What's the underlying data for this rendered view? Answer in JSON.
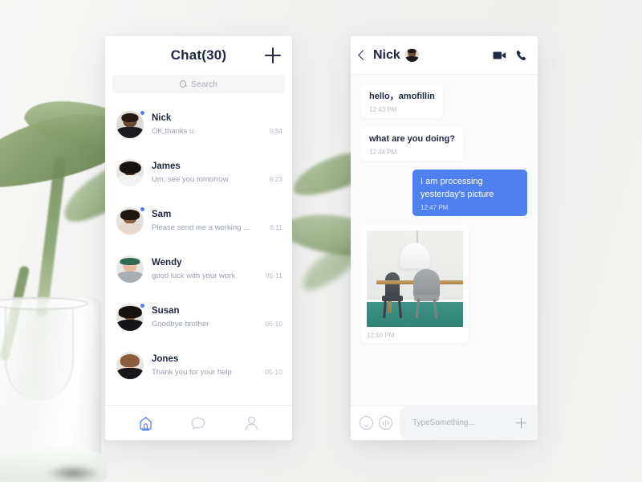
{
  "theme": {
    "accent": "#4f80f0",
    "text_dark": "#1f2740",
    "text_muted": "#9aa0ae",
    "panel_bg": "#ffffff",
    "page_bg": "#f2f2f1"
  },
  "left_panel": {
    "title": "Chat",
    "count_label": "(30)",
    "add_icon": "plus-icon",
    "search": {
      "placeholder": "Search",
      "icon": "search-icon"
    },
    "conversations": [
      {
        "name": "Nick",
        "preview": "OK,thanks u",
        "time": "9:34",
        "unread": true,
        "avatar": "avatar-nick"
      },
      {
        "name": "James",
        "preview": "Um, see you tomorrow",
        "time": "8:23",
        "unread": false,
        "avatar": "avatar-james"
      },
      {
        "name": "Sam",
        "preview": "Please send me a working ...",
        "time": "6:11",
        "unread": true,
        "avatar": "avatar-sam"
      },
      {
        "name": "Wendy",
        "preview": "good luck with your work",
        "time": "05-11",
        "unread": false,
        "avatar": "avatar-wendy"
      },
      {
        "name": "Susan",
        "preview": "Goodbye brother",
        "time": "05-10",
        "unread": true,
        "avatar": "avatar-susan"
      },
      {
        "name": "Jones",
        "preview": "Thank you for your help",
        "time": "05-10",
        "unread": false,
        "avatar": "avatar-jones"
      }
    ],
    "tabs": [
      {
        "icon": "home-icon",
        "active": true
      },
      {
        "icon": "chat-bubble-icon",
        "active": false
      },
      {
        "icon": "profile-icon",
        "active": false
      }
    ]
  },
  "right_panel": {
    "header": {
      "back_icon": "chevron-left-icon",
      "contact_name": "Nick",
      "avatar": "avatar-nick",
      "video_icon": "video-camera-icon",
      "call_icon": "phone-icon"
    },
    "messages": [
      {
        "kind": "text",
        "side": "in",
        "text": "hello，amofillin",
        "time": "12:43 PM"
      },
      {
        "kind": "text",
        "side": "in",
        "text": "what are you doing?",
        "time": "12:44 PM"
      },
      {
        "kind": "text",
        "side": "out",
        "text": "I am processing yesterday's picture",
        "time": "12:47 PM"
      },
      {
        "kind": "photo",
        "side": "in",
        "alt": "dining room with pendant lamp, wooden table and two chairs",
        "time": "12:50 PM"
      }
    ],
    "input": {
      "emoji_icon": "smiley-icon",
      "voice_icon": "voice-waveform-icon",
      "placeholder": "TypeSomething...",
      "plus_icon": "plus-icon"
    }
  }
}
